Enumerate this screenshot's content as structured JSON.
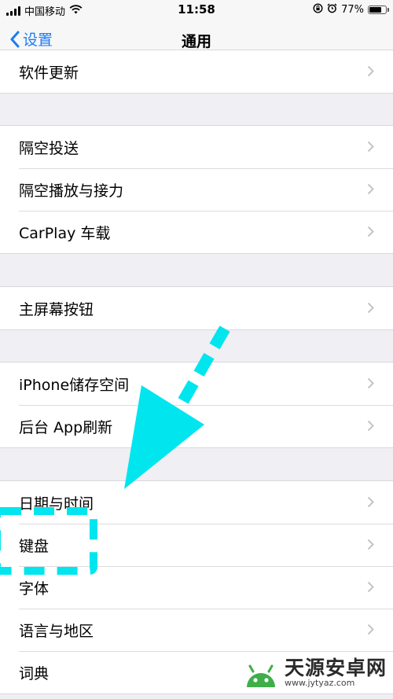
{
  "status_bar": {
    "carrier": "中国移动",
    "time": "11:58",
    "battery_percent": "77%",
    "battery_level": 0.77,
    "icons": [
      "signal-icon",
      "wifi-icon",
      "orientation-lock-icon",
      "alarm-icon",
      "battery-icon"
    ]
  },
  "nav": {
    "back_label": "设置",
    "title": "通用"
  },
  "groups": [
    {
      "rows": [
        {
          "label": "软件更新"
        }
      ]
    },
    {
      "rows": [
        {
          "label": "隔空投送"
        },
        {
          "label": "隔空播放与接力"
        },
        {
          "label": "CarPlay 车载"
        }
      ]
    },
    {
      "rows": [
        {
          "label": "主屏幕按钮"
        }
      ]
    },
    {
      "rows": [
        {
          "label": "iPhone储存空间"
        },
        {
          "label": "后台 App刷新"
        }
      ]
    },
    {
      "rows": [
        {
          "label": "日期与时间"
        },
        {
          "label": "键盘"
        },
        {
          "label": "字体"
        },
        {
          "label": "语言与地区"
        },
        {
          "label": "词典"
        }
      ]
    }
  ],
  "annotation": {
    "color": "#00e5ee",
    "highlighted_item": "键盘"
  },
  "watermark": {
    "title": "天源安卓网",
    "url": "www.jytyaz.com"
  }
}
